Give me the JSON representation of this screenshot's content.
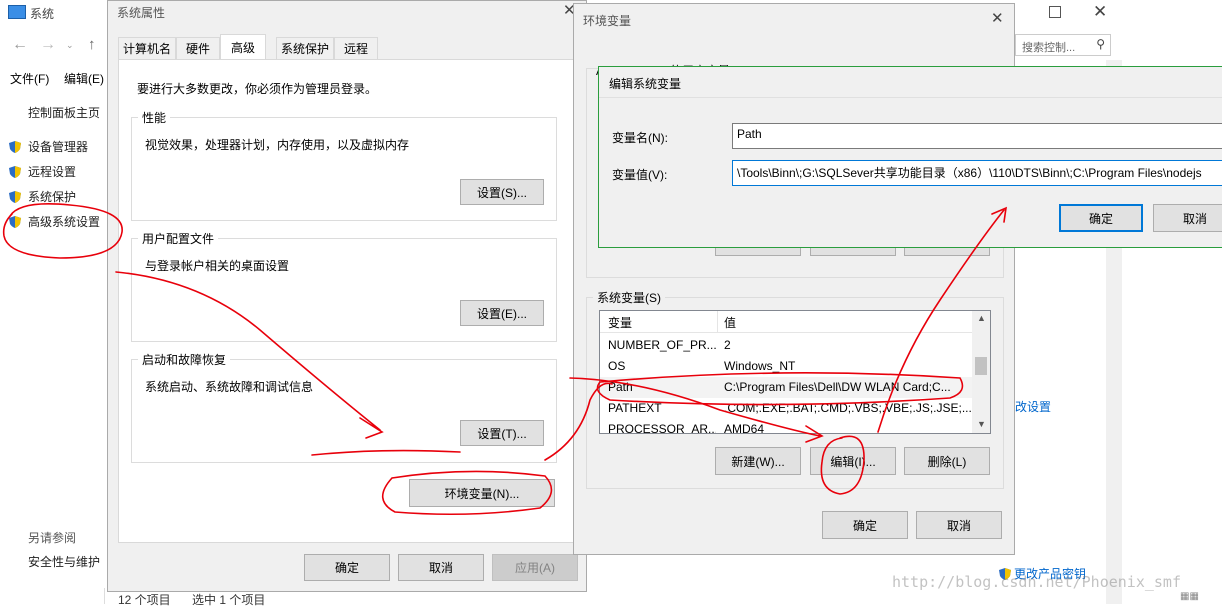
{
  "system_window": {
    "title": "系统",
    "menu": [
      "文件(F)",
      "编辑(E)"
    ],
    "home_link": "控制面板主页",
    "nav_items": [
      "设备管理器",
      "远程设置",
      "系统保护",
      "高级系统设置"
    ],
    "see_also": "另请参阅",
    "security_link": "安全性与维护",
    "status_items": "12 个项目",
    "status_selected": "选中 1 个项目",
    "search_placeholder": "搜索控制...",
    "change_key": "更改产品密钥",
    "settings_link": "改设置"
  },
  "sys_props": {
    "title": "系统属性",
    "tabs": [
      "计算机名",
      "硬件",
      "高级",
      "系统保护",
      "远程"
    ],
    "admin_note": "要进行大多数更改，你必须作为管理员登录。",
    "performance": {
      "title": "性能",
      "desc": "视觉效果，处理器计划，内存使用，以及虚拟内存",
      "button": "设置(S)..."
    },
    "profile": {
      "title": "用户配置文件",
      "desc": "与登录帐户相关的桌面设置",
      "button": "设置(E)..."
    },
    "startup": {
      "title": "启动和故障恢复",
      "desc": "系统启动、系统故障和调试信息",
      "button": "设置(T)..."
    },
    "env_button": "环境变量(N)...",
    "ok": "确定",
    "cancel": "取消",
    "apply": "应用(A)"
  },
  "env_vars": {
    "title": "环境变量",
    "user_group_partial": "Administrator 的用户变量(U)",
    "system_group": "系统变量(S)",
    "col_var": "变量",
    "col_val": "值",
    "rows": [
      {
        "name": "NUMBER_OF_PR...",
        "value": "2"
      },
      {
        "name": "OS",
        "value": "Windows_NT"
      },
      {
        "name": "Path",
        "value": "C:\\Program Files\\Dell\\DW WLAN Card;C..."
      },
      {
        "name": "PATHEXT",
        "value": ".COM;.EXE;.BAT;.CMD;.VBS;.VBE;.JS;.JSE;...."
      },
      {
        "name": "PROCESSOR_AR...",
        "value": "AMD64"
      }
    ],
    "new_btn": "新建(W)...",
    "edit_btn": "编辑(I)...",
    "delete_btn": "删除(L)",
    "ok": "确定",
    "cancel": "取消"
  },
  "edit_dialog": {
    "title": "编辑系统变量",
    "name_label": "变量名(N):",
    "name_value": "Path",
    "value_label": "变量值(V):",
    "value_value": "\\Tools\\Binn\\;G:\\SQLSever共享功能目录（x86）\\110\\DTS\\Binn\\;C:\\Program Files\\nodejs",
    "ok": "确定",
    "cancel": "取消"
  },
  "watermark": "http://blog.csdn.net/Phoenix_smf",
  "colors": {
    "annotation_red": "#e8000b",
    "accent_blue": "#0078d7",
    "link_blue": "#0066cc"
  }
}
